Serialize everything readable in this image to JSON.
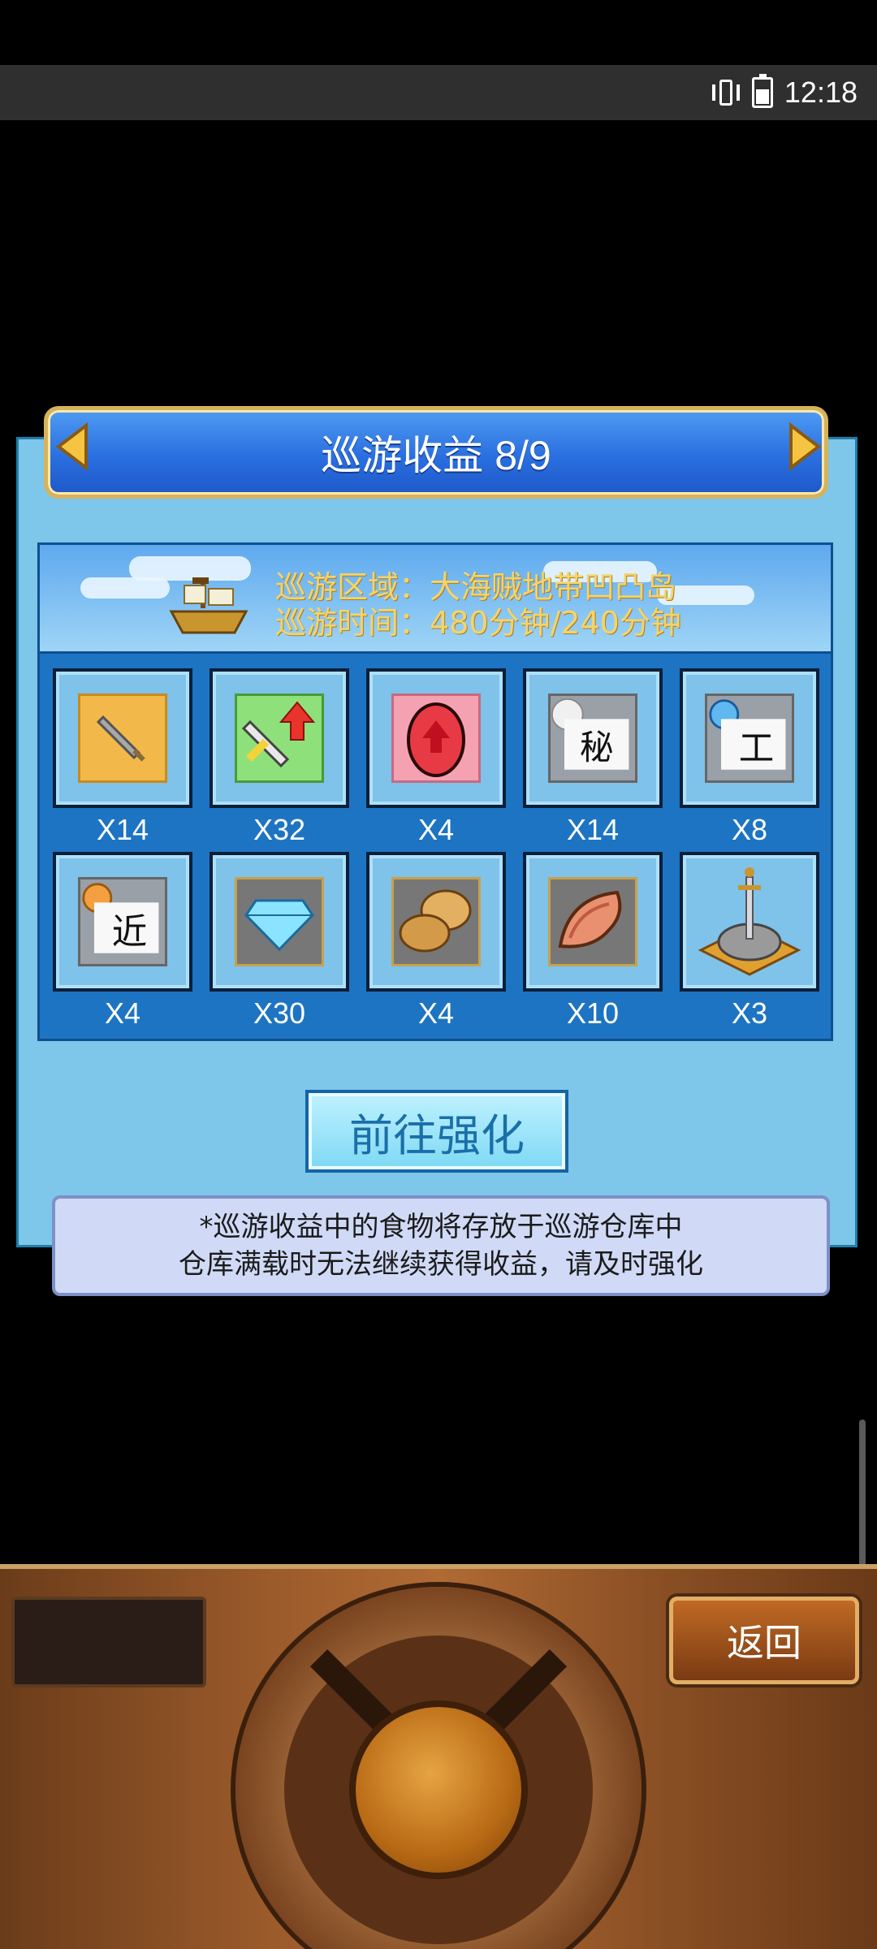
{
  "status_bar": {
    "time": "12:18",
    "icons": [
      "vibrate-icon",
      "battery-charging-icon"
    ]
  },
  "dialog": {
    "title": "巡游收益 8/9",
    "prev_icon": "left-arrow-icon",
    "next_icon": "right-arrow-icon",
    "info": {
      "region": "巡游区域：大海贼地带凹凸岛",
      "time": "巡游时间：480分钟/240分钟",
      "ship_icon": "ship-icon"
    },
    "rewards": [
      {
        "icon": "dagger-icon",
        "qty": "X14"
      },
      {
        "icon": "sword-upgrade-icon",
        "qty": "X32"
      },
      {
        "icon": "red-gem-upgrade-icon",
        "qty": "X4"
      },
      {
        "icon": "secret-scroll-icon",
        "qty": "X14"
      },
      {
        "icon": "craft-scroll-icon",
        "qty": "X8"
      },
      {
        "icon": "near-scroll-icon",
        "qty": "X4"
      },
      {
        "icon": "diamond-icon",
        "qty": "X30"
      },
      {
        "icon": "bread-icon",
        "qty": "X4"
      },
      {
        "icon": "meat-icon",
        "qty": "X10"
      },
      {
        "icon": "sword-in-stone-icon",
        "qty": "X3"
      }
    ],
    "enhance_label": "前往强化",
    "note_line1": "*巡游收益中的食物将存放于巡游仓库中",
    "note_line2": "仓库满载时无法继续获得收益，请及时强化"
  },
  "console": {
    "back_label": "返回"
  },
  "colors": {
    "title_gold": "#f3d46a",
    "panel_blue": "#7ec6ea",
    "content_blue": "#1d74c2"
  }
}
